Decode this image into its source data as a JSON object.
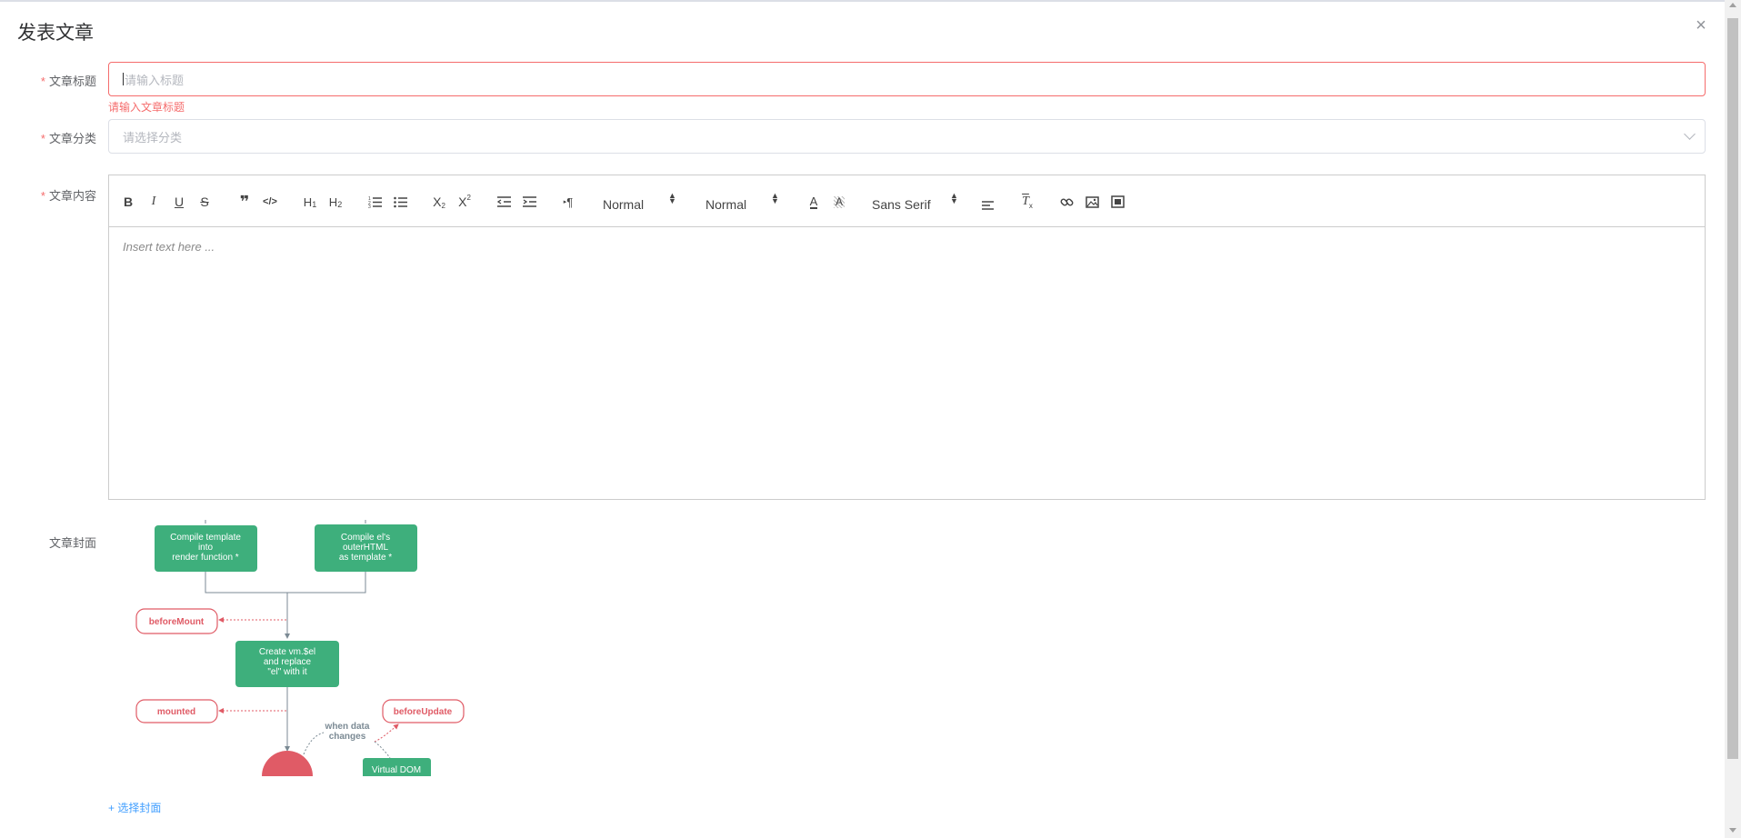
{
  "dialog": {
    "title": "发表文章",
    "close_icon": "×"
  },
  "form": {
    "title_field": {
      "label": "文章标题",
      "placeholder": "请输入标题",
      "value": "",
      "error": "请输入文章标题"
    },
    "category_field": {
      "label": "文章分类",
      "placeholder": "请选择分类",
      "value": ""
    },
    "content_field": {
      "label": "文章内容",
      "placeholder": "Insert text here ..."
    },
    "cover_field": {
      "label": "文章封面",
      "choose_label": "+ 选择封面"
    }
  },
  "toolbar": {
    "bold": "B",
    "italic": "I",
    "underline": "U",
    "strike": "S",
    "blockquote": "❞",
    "code": "</>",
    "h1": "H1",
    "h2": "H2",
    "subscript": "X2",
    "superscript": "X2",
    "paragraph_dir": "¶",
    "size_picker": "Normal",
    "header_picker": "Normal",
    "font_picker": "Sans Serif"
  },
  "cover_diagram": {
    "compile_template": [
      "Compile template",
      "into",
      "render function *"
    ],
    "compile_el": [
      "Compile el's",
      "outerHTML",
      "as template *"
    ],
    "before_mount": "beforeMount",
    "create_vm": [
      "Create vm.$el",
      "and replace",
      "\"el\" with it"
    ],
    "mounted": "mounted",
    "when_data": [
      "when data",
      "changes"
    ],
    "before_update": "beforeUpdate",
    "virtual_dom": "Virtual DOM",
    "colors": {
      "green": "#3eaf7c",
      "red": "#e05b66",
      "line": "#7b8a94"
    }
  }
}
